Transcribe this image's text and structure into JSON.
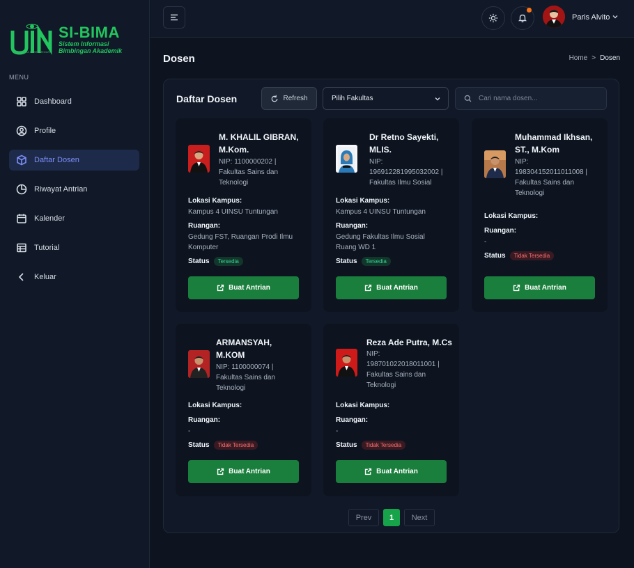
{
  "brand": {
    "title": "SI-BIMA",
    "subtitle_line1": "Sistem Informasi",
    "subtitle_line2": "Bimbingan Akademik",
    "tiny_text": "SUMATERA UTARA MEDAN",
    "color": "#22c55e"
  },
  "sidebar": {
    "heading": "MENU",
    "items": [
      {
        "label": "Dashboard",
        "icon": "grid-icon",
        "active": false
      },
      {
        "label": "Profile",
        "icon": "user-icon",
        "active": false
      },
      {
        "label": "Daftar Dosen",
        "icon": "cube-icon",
        "active": true
      },
      {
        "label": "Riwayat Antrian",
        "icon": "pie-icon",
        "active": false
      },
      {
        "label": "Kalender",
        "icon": "calendar-icon",
        "active": false
      },
      {
        "label": "Tutorial",
        "icon": "table-icon",
        "active": false
      },
      {
        "label": "Keluar",
        "icon": "chevron-left-icon",
        "active": false
      }
    ]
  },
  "header": {
    "user_name": "Paris Alvito",
    "notification_dot_color": "#f97316"
  },
  "page": {
    "title": "Dosen",
    "breadcrumb": {
      "home": "Home",
      "separator": ">",
      "current": "Dosen"
    }
  },
  "toolbar": {
    "title": "Daftar Dosen",
    "refresh_label": "Refresh",
    "faculty_select_value": "Pilih Fakultas",
    "search_placeholder": "Cari nama dosen..."
  },
  "labels": {
    "campus": "Lokasi Kampus:",
    "room": "Ruangan:",
    "status": "Status",
    "cta": "Buat Antrian"
  },
  "lecturers": [
    {
      "name_l1": "M. KHALIL GIBRAN,",
      "name_l2": "M.Kom.",
      "info_l1": "NIP: 1100000202 |",
      "info_l2": "Fakultas Sains dan",
      "info_l3": "Teknologi",
      "campus": "Kampus 4 UINSU Tuntungan",
      "room_l1": "Gedung FST, Ruangan Prodi Ilmu",
      "room_l2": "Komputer",
      "status": "Tersedia",
      "available": true
    },
    {
      "name_l1": "Dr Retno Sayekti,",
      "name_l2": "MLIS.",
      "info_l1": "NIP:",
      "info_l2": "196912281995032002 |",
      "info_l3": "Fakultas Ilmu Sosial",
      "campus": "Kampus 4 UINSU Tuntungan",
      "room_l1": "Gedung Fakultas Ilmu Sosial",
      "room_l2": "Ruang WD 1",
      "status": "Tersedia",
      "available": true
    },
    {
      "name_l1": "Muhammad Ikhsan,",
      "name_l2": "ST., M.Kom",
      "info_l1": "NIP:",
      "info_l2": "198304152011011008 |",
      "info_l3": "Fakultas Sains dan",
      "info_l4": "Teknologi",
      "campus": "",
      "room_l1": "-",
      "status": "Tidak Tersedia",
      "available": false
    },
    {
      "name_l1": "ARMANSYAH,",
      "name_l2": "M.KOM",
      "info_l1": "NIP: 1100000074 |",
      "info_l2": "Fakultas Sains dan",
      "info_l3": "Teknologi",
      "campus": "",
      "room_l1": "-",
      "status": "Tidak Tersedia",
      "available": false
    },
    {
      "name_l1": "Reza Ade Putra, M.Cs",
      "info_l1": "NIP:",
      "info_l2": "198701022018011001 |",
      "info_l3": "Fakultas Sains dan",
      "info_l4": "Teknologi",
      "campus": "",
      "room_l1": "-",
      "status": "Tidak Tersedia",
      "available": false
    }
  ],
  "pagination": {
    "prev": "Prev",
    "current": "1",
    "next": "Next"
  }
}
